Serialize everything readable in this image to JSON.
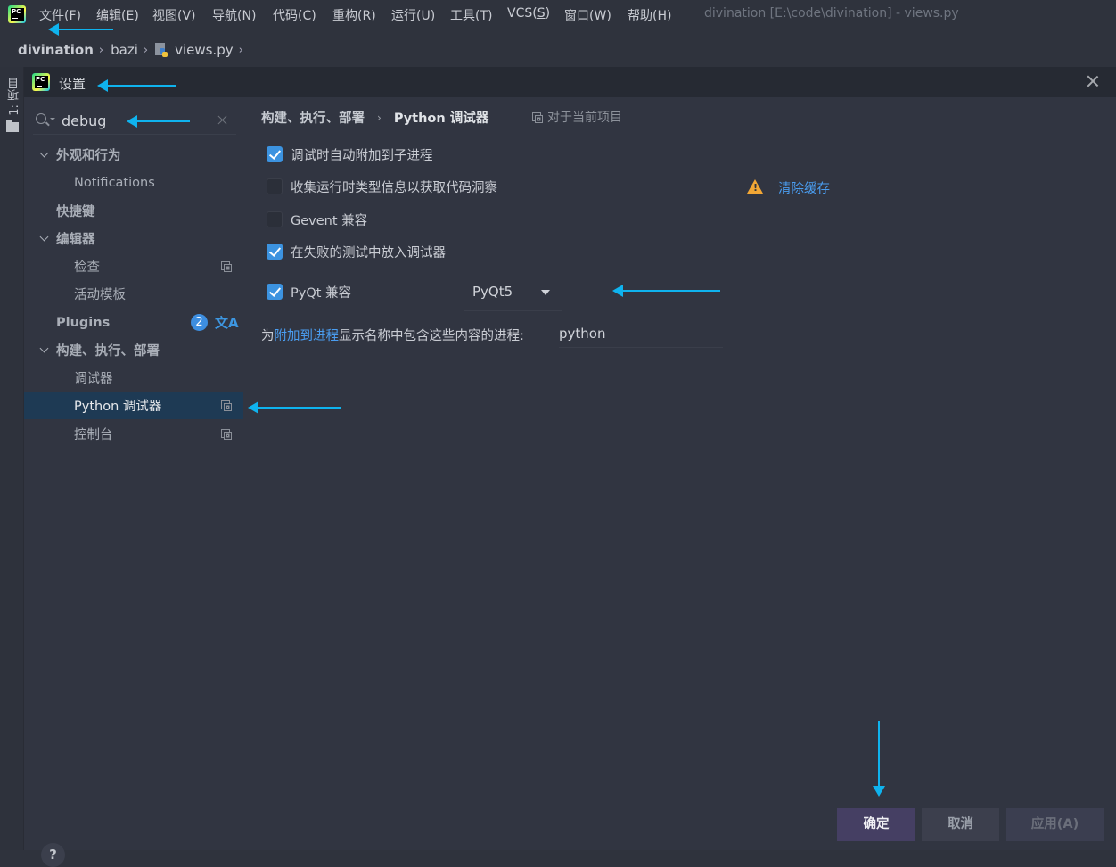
{
  "menubar": {
    "items": [
      {
        "label": "文件",
        "key": "F"
      },
      {
        "label": "编辑",
        "key": "E"
      },
      {
        "label": "视图",
        "key": "V"
      },
      {
        "label": "导航",
        "key": "N"
      },
      {
        "label": "代码",
        "key": "C"
      },
      {
        "label": "重构",
        "key": "R"
      },
      {
        "label": "运行",
        "key": "U"
      },
      {
        "label": "工具",
        "key": "T"
      },
      {
        "label": "VCS",
        "key": "S"
      },
      {
        "label": "窗口",
        "key": "W"
      },
      {
        "label": "帮助",
        "key": "H"
      }
    ],
    "window_title": "divination [E:\\code\\divination] - views.py"
  },
  "breadcrumb": {
    "project": "divination",
    "folder": "bazi",
    "file": "views.py",
    "separator": "›"
  },
  "side_strip": {
    "project_tab": "1: 项目"
  },
  "dialog": {
    "title": "设置",
    "search": {
      "value": "debug"
    },
    "tree": [
      {
        "label": "外观和行为",
        "level": 1,
        "expanded": true
      },
      {
        "label": "Notifications",
        "level": 2
      },
      {
        "label": "快捷键",
        "level": 1
      },
      {
        "label": "编辑器",
        "level": 1,
        "expanded": true
      },
      {
        "label": "检查",
        "level": 2,
        "project_scoped": true
      },
      {
        "label": "活动模板",
        "level": 2
      },
      {
        "label": "Plugins",
        "level": 1,
        "badge": "2"
      },
      {
        "label": "构建、执行、部署",
        "level": 1,
        "expanded": true
      },
      {
        "label": "调试器",
        "level": 2
      },
      {
        "label": "Python 调试器",
        "level": 2,
        "selected": true,
        "project_scoped": true
      },
      {
        "label": "控制台",
        "level": 2,
        "project_scoped": true
      }
    ],
    "content": {
      "crumb_parent": "构建、执行、部署",
      "crumb_arrow": "›",
      "crumb_current": "Python 调试器",
      "scope_label": "对于当前项目",
      "options": [
        {
          "label": "调试时自动附加到子进程",
          "checked": true
        },
        {
          "label": "收集运行时类型信息以获取代码洞察",
          "checked": false
        },
        {
          "label": "Gevent 兼容",
          "checked": false
        },
        {
          "label": "在失败的测试中放入调试器",
          "checked": true
        },
        {
          "label": "PyQt 兼容",
          "checked": true
        }
      ],
      "clear_cache_link": "清除缓存",
      "pyqt_dropdown_value": "PyQt5",
      "process_label_prefix": "为",
      "process_label_link": "附加到进程",
      "process_label_suffix": "显示名称中包含这些内容的进程:",
      "process_filter_value": "python"
    },
    "buttons": {
      "ok": "确定",
      "cancel": "取消",
      "apply": "应用(A)",
      "help": "?"
    }
  },
  "colors": {
    "accent": "#3c93e0",
    "link": "#4a9df0",
    "selection": "#1e3a54",
    "warning": "#f2a735",
    "annotation_arrow": "#0fb3ee",
    "ok_button": "#453f63"
  }
}
